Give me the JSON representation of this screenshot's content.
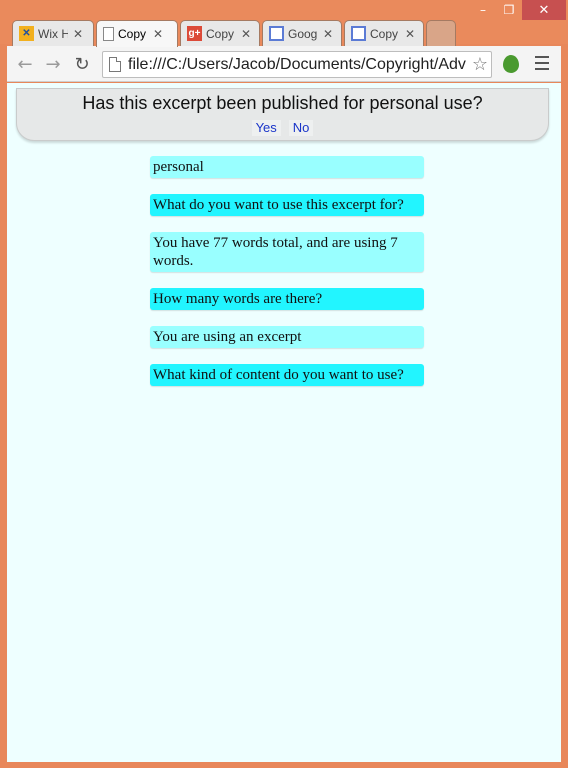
{
  "window": {
    "minimize_glyph": "–",
    "maximize_glyph": "❐",
    "close_glyph": "✕"
  },
  "tabs": [
    {
      "label": "Wix H",
      "icon": "wix-icon",
      "icon_color": "#f2b01e",
      "icon_glyph": "✕",
      "active": false
    },
    {
      "label": "Copy",
      "icon": "page-icon",
      "icon_color": "#ffffff",
      "icon_glyph": "",
      "active": true
    },
    {
      "label": "Copy",
      "icon": "google-plus-icon",
      "icon_color": "#dc4a38",
      "icon_glyph": "g+",
      "active": false
    },
    {
      "label": "Goog",
      "icon": "sites-icon",
      "icon_color": "#5b7bd5",
      "icon_glyph": "",
      "active": false
    },
    {
      "label": "Copy",
      "icon": "sites-icon",
      "icon_color": "#5b7bd5",
      "icon_glyph": "",
      "active": false
    }
  ],
  "tab_close_glyph": "✕",
  "toolbar": {
    "back_glyph": "←",
    "forward_glyph": "→",
    "reload_glyph": "↻",
    "url": "file:///C:/Users/Jacob/Documents/Copyright/Adv",
    "star_glyph": "☆"
  },
  "question": {
    "text": "Has this excerpt been published for personal use?",
    "yes_label": "Yes",
    "no_label": "No"
  },
  "history": [
    {
      "kind": "answer",
      "text": "personal"
    },
    {
      "kind": "question",
      "text": "What do you want to use this excerpt for?"
    },
    {
      "kind": "answer",
      "text": "You have 77 words total, and are using 7 words."
    },
    {
      "kind": "question",
      "text": "How many words are there?"
    },
    {
      "kind": "answer",
      "text": "You are using an excerpt"
    },
    {
      "kind": "question",
      "text": "What kind of content do you want to use?"
    }
  ],
  "colors": {
    "frame": "#e8875a",
    "page_background": "#eeffff",
    "answer_bubble": "#99ffff",
    "question_bubble": "#22f5ff",
    "link": "#1a35c9"
  }
}
